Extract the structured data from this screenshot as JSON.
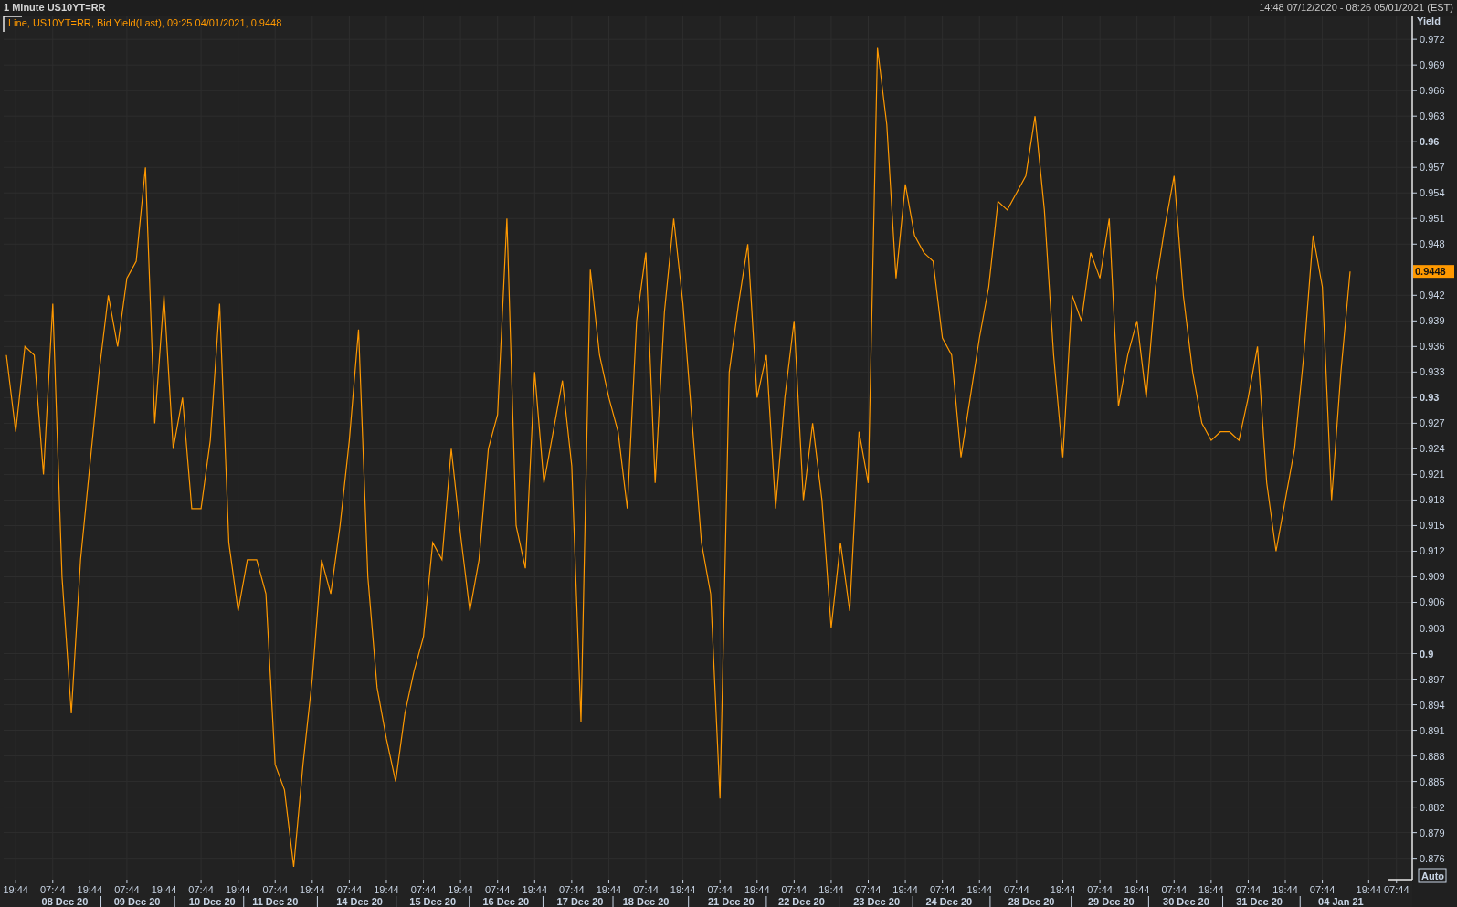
{
  "header": {
    "title": "1 Minute US10YT=RR",
    "range": "14:48 07/12/2020 - 08:26 05/01/2021 (EST)"
  },
  "chart": {
    "legend": "Line, US10YT=RR, Bid Yield(Last), 09:25 04/01/2021, 0.9448",
    "auto_button": "Auto",
    "date_labels": [
      "08 Dec 20",
      "09 Dec 20",
      "10 Dec 20",
      "11 Dec 20",
      "14 Dec 20",
      "15 Dec 20",
      "16 Dec 20",
      "17 Dec 20",
      "18 Dec 20",
      "21 Dec 20",
      "22 Dec 20",
      "23 Dec 20",
      "24 Dec 20",
      "28 Dec 20",
      "29 Dec 20",
      "30 Dec 20",
      "31 Dec 20",
      "04 Jan 21"
    ],
    "chart_data": {
      "type": "line",
      "ylabel": "Yield",
      "ylim": [
        0.8735,
        0.9748
      ],
      "categories": [
        null,
        "19:44",
        null,
        null,
        null,
        "07:44",
        null,
        null,
        null,
        "19:44",
        null,
        null,
        null,
        "07:44",
        null,
        null,
        null,
        "19:44",
        null,
        null,
        null,
        "07:44",
        null,
        null,
        null,
        "19:44",
        null,
        null,
        null,
        "07:44",
        null,
        null,
        null,
        "19:44",
        null,
        null,
        null,
        "07:44",
        null,
        null,
        null,
        "19:44",
        null,
        null,
        null,
        "07:44",
        null,
        null,
        null,
        "19:44",
        null,
        null,
        null,
        "07:44",
        null,
        null,
        null,
        "19:44",
        null,
        null,
        null,
        "07:44",
        null,
        null,
        null,
        "19:44",
        null,
        null,
        null,
        "07:44",
        null,
        null,
        null,
        "19:44",
        null,
        null,
        null,
        "07:44",
        null,
        null,
        null,
        "19:44",
        null,
        null,
        null,
        "07:44",
        null,
        null,
        null,
        "19:44",
        null,
        null,
        null,
        "07:44",
        null,
        null,
        null,
        "19:44",
        null,
        null,
        null,
        "07:44",
        null,
        null,
        null,
        "19:44",
        null,
        null,
        null,
        "07:44",
        null,
        null,
        null,
        null,
        "19:44",
        null,
        null,
        null,
        "07:44",
        null,
        null,
        null,
        "19:44",
        null,
        null,
        null,
        "07:44",
        null,
        null,
        null,
        "19:44",
        null,
        null,
        null,
        "07:44",
        null,
        null,
        null,
        "19:44",
        null,
        null,
        null,
        "07:44",
        null,
        null,
        null,
        null,
        "19:44",
        null,
        null,
        "07:44",
        null
      ],
      "series": [
        {
          "color": "#ff9900",
          "values": [
            0.935,
            0.926,
            0.936,
            0.935,
            0.921,
            0.941,
            0.909,
            0.893,
            0.911,
            0.922,
            0.933,
            0.942,
            0.936,
            0.944,
            0.946,
            0.957,
            0.927,
            0.942,
            0.924,
            0.93,
            0.917,
            0.917,
            0.925,
            0.941,
            0.913,
            0.905,
            0.911,
            0.911,
            0.907,
            0.887,
            0.884,
            0.875,
            0.887,
            0.897,
            0.911,
            0.907,
            0.915,
            0.925,
            0.938,
            0.909,
            0.896,
            0.89,
            0.885,
            0.893,
            0.898,
            0.902,
            0.913,
            0.911,
            0.924,
            0.914,
            0.905,
            0.911,
            0.924,
            0.928,
            0.951,
            0.915,
            0.91,
            0.933,
            0.92,
            0.926,
            0.932,
            0.922,
            0.892,
            0.945,
            0.935,
            0.93,
            0.926,
            0.917,
            0.939,
            0.947,
            0.92,
            0.94,
            0.951,
            0.941,
            0.927,
            0.913,
            0.907,
            0.883,
            0.933,
            0.941,
            0.948,
            0.93,
            0.935,
            0.917,
            0.93,
            0.939,
            0.918,
            0.927,
            0.918,
            0.903,
            0.913,
            0.905,
            0.926,
            0.92,
            0.971,
            0.962,
            0.944,
            0.955,
            0.949,
            0.947,
            0.946,
            0.937,
            0.935,
            0.923,
            0.93,
            0.937,
            0.943,
            0.953,
            0.952,
            0.954,
            0.956,
            0.963,
            0.952,
            0.935,
            0.923,
            0.942,
            0.939,
            0.947,
            0.944,
            0.951,
            0.929,
            0.935,
            0.939,
            0.93,
            0.943,
            0.95,
            0.956,
            0.942,
            0.933,
            0.927,
            0.925,
            0.926,
            0.926,
            0.925,
            0.93,
            0.936,
            0.92,
            0.912,
            0.918,
            0.924,
            0.935,
            0.949,
            0.943,
            0.918,
            0.933,
            0.9448,
            null,
            null,
            null,
            null,
            null,
            null
          ]
        }
      ],
      "yticks": [
        {
          "value": 0.972,
          "label": "0.972"
        },
        {
          "value": 0.969,
          "label": "0.969"
        },
        {
          "value": 0.966,
          "label": "0.966"
        },
        {
          "value": 0.963,
          "label": "0.963"
        },
        {
          "value": 0.96,
          "label": "0.96"
        },
        {
          "value": 0.957,
          "label": "0.957"
        },
        {
          "value": 0.954,
          "label": "0.954"
        },
        {
          "value": 0.951,
          "label": "0.951"
        },
        {
          "value": 0.948,
          "label": "0.948"
        },
        {
          "value": 0.942,
          "label": "0.942"
        },
        {
          "value": 0.939,
          "label": "0.939"
        },
        {
          "value": 0.936,
          "label": "0.936"
        },
        {
          "value": 0.933,
          "label": "0.933"
        },
        {
          "value": 0.93,
          "label": "0.93"
        },
        {
          "value": 0.927,
          "label": "0.927"
        },
        {
          "value": 0.924,
          "label": "0.924"
        },
        {
          "value": 0.921,
          "label": "0.921"
        },
        {
          "value": 0.918,
          "label": "0.918"
        },
        {
          "value": 0.915,
          "label": "0.915"
        },
        {
          "value": 0.912,
          "label": "0.912"
        },
        {
          "value": 0.909,
          "label": "0.909"
        },
        {
          "value": 0.906,
          "label": "0.906"
        },
        {
          "value": 0.903,
          "label": "0.903"
        },
        {
          "value": 0.9,
          "label": "0.9"
        },
        {
          "value": 0.897,
          "label": "0.897"
        },
        {
          "value": 0.894,
          "label": "0.894"
        },
        {
          "value": 0.891,
          "label": "0.891"
        },
        {
          "value": 0.888,
          "label": "0.888"
        },
        {
          "value": 0.885,
          "label": "0.885"
        },
        {
          "value": 0.882,
          "label": "0.882"
        },
        {
          "value": 0.879,
          "label": "0.879"
        },
        {
          "value": 0.876,
          "label": "0.876"
        }
      ],
      "grid": true
    },
    "last_value": "0.9448"
  }
}
